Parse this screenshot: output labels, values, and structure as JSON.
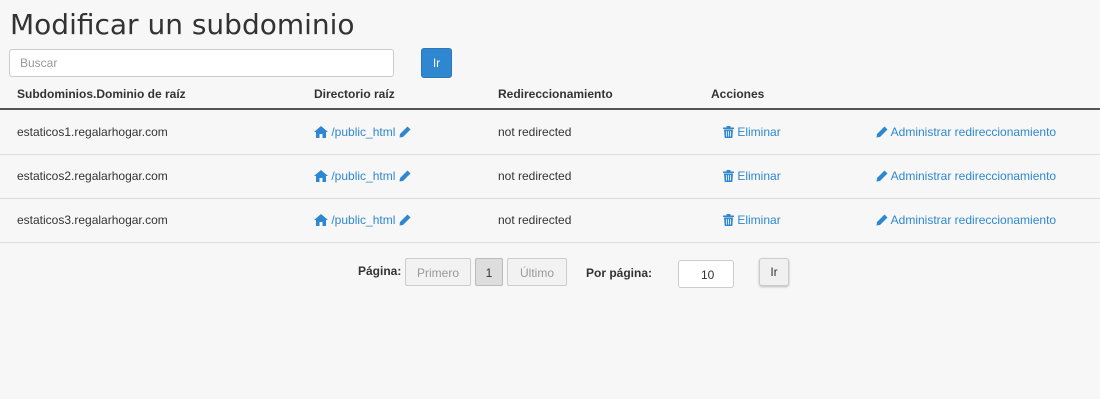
{
  "page": {
    "title": "Modificar un subdominio"
  },
  "search": {
    "placeholder": "Buscar",
    "go_label": "Ir"
  },
  "table": {
    "headers": {
      "subdomain": "Subdominios.Dominio de raíz",
      "docroot": "Directorio raíz",
      "redirect": "Redireccionamiento",
      "actions": "Acciones"
    },
    "rows": [
      {
        "subdomain": "estaticos1.regalarhogar.com",
        "docroot": "/public_html",
        "redirect": "not redirected",
        "delete": "Eliminar",
        "manage": "Administrar redireccionamiento"
      },
      {
        "subdomain": "estaticos2.regalarhogar.com",
        "docroot": "/public_html",
        "redirect": "not redirected",
        "delete": "Eliminar",
        "manage": "Administrar redireccionamiento"
      },
      {
        "subdomain": "estaticos3.regalarhogar.com",
        "docroot": "/public_html",
        "redirect": "not redirected",
        "delete": "Eliminar",
        "manage": "Administrar redireccionamiento"
      }
    ]
  },
  "pagination": {
    "page_label": "Página:",
    "first": "Primero",
    "current": "1",
    "last": "Último",
    "per_page_label": "Por página:",
    "per_page_value": "10",
    "go_label": "Ir"
  },
  "colors": {
    "link": "#2f87d0",
    "primary_button": "#2f87d0"
  },
  "icons": {
    "docroot": "home-icon",
    "edit": "pencil-icon",
    "delete": "trash-icon"
  }
}
